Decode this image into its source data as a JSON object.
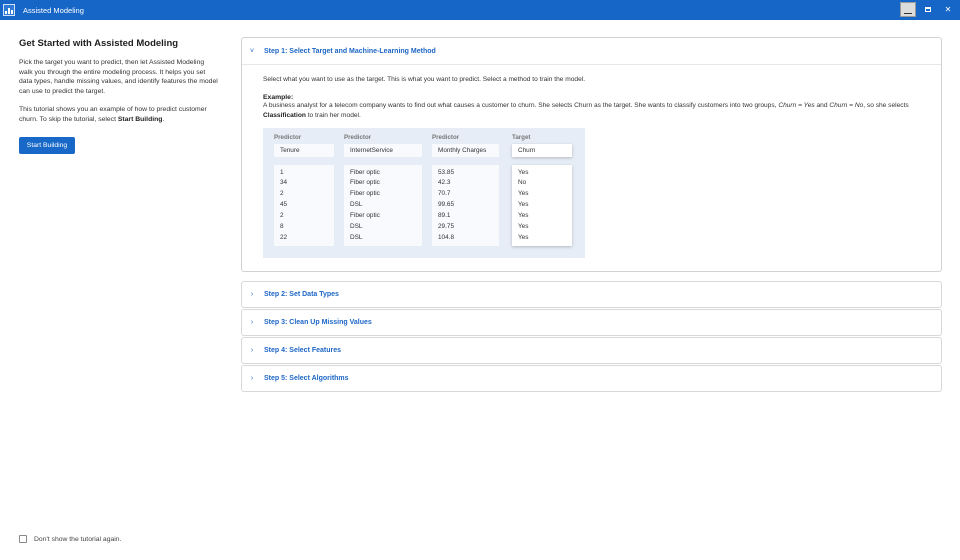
{
  "window": {
    "title": "Assisted Modeling",
    "minimize": "_",
    "close": "✕"
  },
  "left": {
    "title": "Get Started with Assisted Modeling",
    "para1": "Pick the target you want to predict, then let Assisted Modeling walk you through the entire modeling process. It helps you set data types, handle missing values, and identify features the model can use to predict the target.",
    "para2_pre": "This tutorial shows you an example of how to predict customer churn. To skip the tutorial, select ",
    "para2_bold": "Start Building",
    "para2_post": ".",
    "start_button": "Start Building"
  },
  "footer": {
    "checkbox_label": "Don't show the tutorial again."
  },
  "steps": [
    {
      "title": "Step 1: Select Target and Machine-Learning Method",
      "chevron": "˅",
      "intro": "Select what you want to use as the target. This is what you want to predict. Select a method to train the model.",
      "example_heading": "Example:",
      "example_p1": "A business analyst for a telecom company wants to find out what causes a customer to churn. She selects Churn as the target. She wants to classify customers into two groups, ",
      "example_i1": "Churn = Yes",
      "example_p2": " and ",
      "example_i2": "Churn = No",
      "example_p3": ", so she selects ",
      "example_b": "Classification",
      "example_p4": " to train her model."
    },
    {
      "title": "Step 2: Set Data Types",
      "chevron": "›"
    },
    {
      "title": "Step 3: Clean Up Missing Values",
      "chevron": "›"
    },
    {
      "title": "Step 4: Select Features",
      "chevron": "›"
    },
    {
      "title": "Step 5: Select Algorithms",
      "chevron": "›"
    }
  ],
  "demo": {
    "columns": [
      {
        "role": "Predictor",
        "name": "Tenure",
        "values": [
          "1",
          "34",
          "2",
          "45",
          "2",
          "8",
          "22"
        ]
      },
      {
        "role": "Predictor",
        "name": "InternetService",
        "values": [
          "Fiber optic",
          "Fiber optic",
          "Fiber optic",
          "DSL",
          "Fiber optic",
          "DSL",
          "DSL"
        ]
      },
      {
        "role": "Predictor",
        "name": "Monthly Charges",
        "values": [
          "53.85",
          "42.3",
          "70.7",
          "99.65",
          "89.1",
          "29.75",
          "104.8"
        ]
      },
      {
        "role": "Target",
        "name": "Churn",
        "values": [
          "Yes",
          "No",
          "Yes",
          "Yes",
          "Yes",
          "Yes",
          "Yes"
        ]
      }
    ]
  },
  "colors": {
    "titlebar": "#1666c7",
    "accent": "#1d66c6",
    "button": "#1868c8",
    "demo_bg": "#e7edf6"
  }
}
